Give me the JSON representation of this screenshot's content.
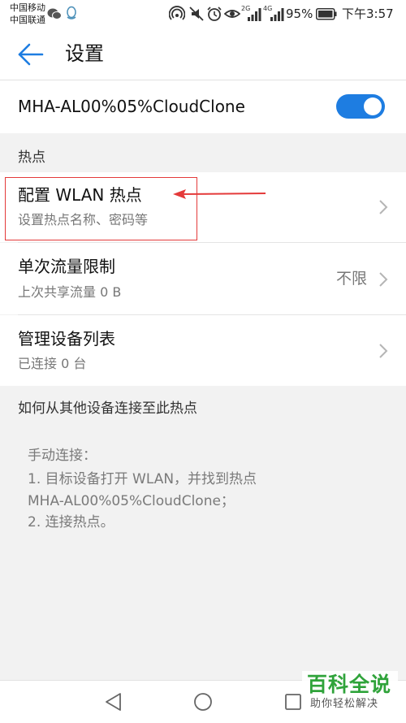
{
  "status_bar": {
    "carrier1": "中国移动",
    "carrier2": "中国联通",
    "sig1_tag": "2G",
    "sig2_tag": "4G",
    "battery": "95%",
    "time": "下午3:57"
  },
  "header": {
    "title": "设置",
    "back_icon": "back-arrow-icon"
  },
  "hotspot": {
    "name": "MHA-AL00%05%CloudClone",
    "enabled": true,
    "accent": "#1e7de1"
  },
  "section_hotspot": "热点",
  "items": [
    {
      "title": "配置 WLAN 热点",
      "subtitle": "设置热点名称、密码等",
      "value": ""
    },
    {
      "title": "单次流量限制",
      "subtitle": "上次共享流量 0 B",
      "value": "不限"
    },
    {
      "title": "管理设备列表",
      "subtitle": "已连接 0 台",
      "value": ""
    }
  ],
  "section_howto": "如何从其他设备连接至此热点",
  "howto": {
    "line1": "手动连接：",
    "line2": "1. 目标设备打开 WLAN，并找到热点",
    "line3": "MHA-AL00%05%CloudClone；",
    "line4": "2. 连接热点。"
  },
  "watermark": {
    "title": "百科全说",
    "subtitle": "助你轻松解决"
  },
  "annotation_color": "#e43a3a"
}
